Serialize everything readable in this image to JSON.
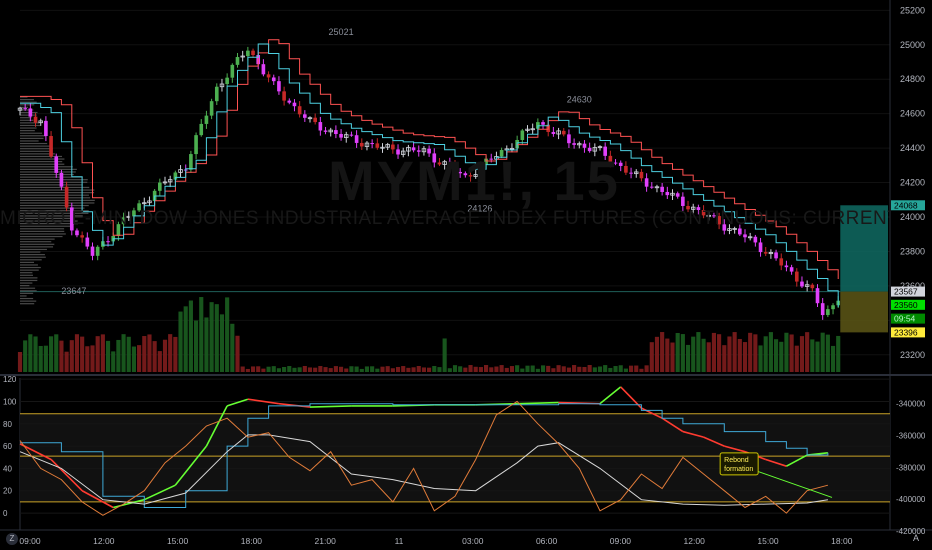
{
  "watermark": {
    "symbol": "MYM1!, 15",
    "description": "MICRO E-MINI DOW JONES INDUSTRIAL AVERAGE INDEX FUTURES (CONTINUOUS: CURRENT CONTRACT IN FRONT)"
  },
  "corner": {
    "left": "Z",
    "right": "A"
  },
  "colors": {
    "up_candle": "#4caf50",
    "down_candle": "#e040fb",
    "red_candle": "#c62828",
    "hollow_candle": "#d1d4dc",
    "red_line": "#ff5252",
    "cyan_line": "#4dd0e1",
    "stoch_green": "#66ff33",
    "stoch_red": "#ff3b30",
    "stoch_cyan": "#3fa9d8",
    "stoch_white": "#d8d8d8",
    "stoch_orange": "#e07b39",
    "level_line": "#c9a227",
    "box_teal": "#0f6b63",
    "box_olive": "#5d5716"
  },
  "chart_data": [
    {
      "type": "candlestick",
      "timeframe_label": "15",
      "x_ticks": [
        "09:00",
        "12:00",
        "15:00",
        "18:00",
        "21:00",
        "11",
        "03:00",
        "06:00",
        "09:00",
        "12:00",
        "15:00",
        "18:00"
      ],
      "y_ticks": [
        25200,
        25000,
        24800,
        24600,
        24400,
        24200,
        24000,
        23800,
        23600,
        23400,
        23200
      ],
      "ylim": [
        23100,
        25260
      ],
      "annotations": [
        {
          "text": "25021",
          "x": 15.5,
          "value": 25021
        },
        {
          "text": "24630",
          "x": 27.0,
          "value": 24630
        },
        {
          "text": "24126",
          "x": 22.2,
          "value": 24126
        },
        {
          "text": "23647",
          "x": 2.6,
          "value": 23647
        }
      ],
      "price_labels": [
        {
          "text": "24068",
          "value": 24068,
          "bg": "#26a69a",
          "fg": "#000000"
        },
        {
          "text": "23567",
          "value": 23567,
          "bg": "#d1d4dc",
          "fg": "#000000"
        },
        {
          "text": "23560",
          "value": 23490,
          "bg": "#00e000",
          "fg": "#000000"
        },
        {
          "text": "09:54",
          "value": 23410,
          "bg": "#008a00",
          "fg": "#b9f6ca"
        },
        {
          "text": "23396",
          "value": 23330,
          "bg": "#ffeb3b",
          "fg": "#000000"
        }
      ],
      "candles_keypoints": [
        {
          "x": 0.0,
          "value": 24620
        },
        {
          "x": 1.0,
          "value": 24560
        },
        {
          "x": 2.5,
          "value": 23950
        },
        {
          "x": 3.5,
          "value": 23780
        },
        {
          "x": 5.0,
          "value": 23980
        },
        {
          "x": 6.5,
          "value": 24150
        },
        {
          "x": 8.0,
          "value": 24300
        },
        {
          "x": 9.5,
          "value": 24750
        },
        {
          "x": 11.0,
          "value": 24980
        },
        {
          "x": 12.3,
          "value": 24750
        },
        {
          "x": 14.0,
          "value": 24550
        },
        {
          "x": 15.5,
          "value": 24470
        },
        {
          "x": 17.5,
          "value": 24400
        },
        {
          "x": 19.5,
          "value": 24380
        },
        {
          "x": 21.5,
          "value": 24230
        },
        {
          "x": 23.5,
          "value": 24400
        },
        {
          "x": 25.0,
          "value": 24550
        },
        {
          "x": 26.5,
          "value": 24440
        },
        {
          "x": 28.0,
          "value": 24380
        },
        {
          "x": 29.5,
          "value": 24250
        },
        {
          "x": 31.0,
          "value": 24150
        },
        {
          "x": 32.5,
          "value": 24050
        },
        {
          "x": 34.0,
          "value": 23950
        },
        {
          "x": 35.5,
          "value": 23850
        },
        {
          "x": 37.0,
          "value": 23700
        },
        {
          "x": 38.3,
          "value": 23560
        },
        {
          "x": 38.8,
          "value": 23420
        },
        {
          "x": 39.5,
          "value": 23540
        }
      ],
      "boxes": [
        {
          "from": 24068,
          "to": 23567,
          "color": "teal"
        },
        {
          "from": 23567,
          "to": 23330,
          "color": "olive"
        }
      ]
    },
    {
      "type": "line",
      "y_ticks": [
        120,
        100,
        80,
        60,
        40,
        20,
        0
      ],
      "y2_ticks": [
        -340000,
        -360000,
        -380000,
        -400000,
        -420000
      ],
      "ylim": [
        -8,
        121
      ],
      "levels": [
        89,
        51,
        10
      ],
      "annotations": [
        {
          "text": "Rebond\nformation",
          "x": 33.8,
          "value": 45
        }
      ],
      "series": [
        {
          "key": "green_red",
          "values": [
            [
              0,
              62
            ],
            [
              1.5,
              48
            ],
            [
              3,
              20
            ],
            [
              4.5,
              5
            ],
            [
              6,
              12
            ],
            [
              7.5,
              25
            ],
            [
              9,
              60
            ],
            [
              10,
              96
            ],
            [
              11,
              102
            ],
            [
              12.5,
              98
            ],
            [
              14,
              95
            ],
            [
              16,
              96
            ],
            [
              18,
              96
            ],
            [
              20,
              97
            ],
            [
              22,
              97
            ],
            [
              24,
              98
            ],
            [
              26,
              99
            ],
            [
              28,
              98
            ],
            [
              29,
              113
            ],
            [
              30,
              94
            ],
            [
              31,
              85
            ],
            [
              32,
              73
            ],
            [
              33,
              68
            ],
            [
              34,
              60
            ],
            [
              35,
              55
            ],
            [
              36,
              48
            ],
            [
              37,
              42
            ],
            [
              38,
              52
            ],
            [
              39,
              54
            ]
          ]
        },
        {
          "key": "cyan",
          "values": [
            [
              0,
              63
            ],
            [
              2,
              55
            ],
            [
              4,
              15
            ],
            [
              6,
              5
            ],
            [
              8,
              20
            ],
            [
              10,
              60
            ],
            [
              11,
              85
            ],
            [
              12,
              96
            ],
            [
              14,
              98
            ],
            [
              18,
              97
            ],
            [
              22,
              97
            ],
            [
              26,
              98
            ],
            [
              28,
              97
            ],
            [
              30,
              92
            ],
            [
              31,
              85
            ],
            [
              32,
              80
            ],
            [
              34,
              73
            ],
            [
              36,
              64
            ],
            [
              37,
              58
            ],
            [
              38,
              52
            ],
            [
              39,
              54
            ]
          ]
        },
        {
          "key": "white",
          "values": [
            [
              0,
              55
            ],
            [
              2,
              40
            ],
            [
              4,
              12
            ],
            [
              6,
              8
            ],
            [
              8,
              18
            ],
            [
              10,
              55
            ],
            [
              11,
              70
            ],
            [
              12,
              70
            ],
            [
              14,
              64
            ],
            [
              16,
              35
            ],
            [
              18,
              30
            ],
            [
              20,
              22
            ],
            [
              22,
              20
            ],
            [
              24,
              45
            ],
            [
              25,
              60
            ],
            [
              26,
              63
            ],
            [
              28,
              40
            ],
            [
              30,
              12
            ],
            [
              32,
              8
            ],
            [
              34,
              7
            ],
            [
              36,
              8
            ],
            [
              38,
              9
            ],
            [
              39,
              12
            ]
          ]
        },
        {
          "key": "orange",
          "values": [
            [
              0,
              65
            ],
            [
              1,
              40
            ],
            [
              2,
              30
            ],
            [
              3,
              10
            ],
            [
              4,
              -2
            ],
            [
              5,
              8
            ],
            [
              6,
              20
            ],
            [
              7,
              45
            ],
            [
              8,
              60
            ],
            [
              9,
              78
            ],
            [
              10,
              85
            ],
            [
              11,
              68
            ],
            [
              12,
              72
            ],
            [
              13,
              50
            ],
            [
              14,
              38
            ],
            [
              15,
              55
            ],
            [
              16,
              25
            ],
            [
              17,
              30
            ],
            [
              18,
              10
            ],
            [
              19,
              40
            ],
            [
              20,
              2
            ],
            [
              21,
              15
            ],
            [
              22,
              48
            ],
            [
              23,
              88
            ],
            [
              24,
              100
            ],
            [
              25,
              80
            ],
            [
              26,
              62
            ],
            [
              27,
              40
            ],
            [
              28,
              2
            ],
            [
              29,
              12
            ],
            [
              30,
              35
            ],
            [
              31,
              22
            ],
            [
              32,
              50
            ],
            [
              33,
              35
            ],
            [
              34,
              20
            ],
            [
              35,
              5
            ],
            [
              36,
              15
            ],
            [
              37,
              0
            ],
            [
              38,
              20
            ],
            [
              39,
              25
            ]
          ]
        }
      ]
    }
  ]
}
